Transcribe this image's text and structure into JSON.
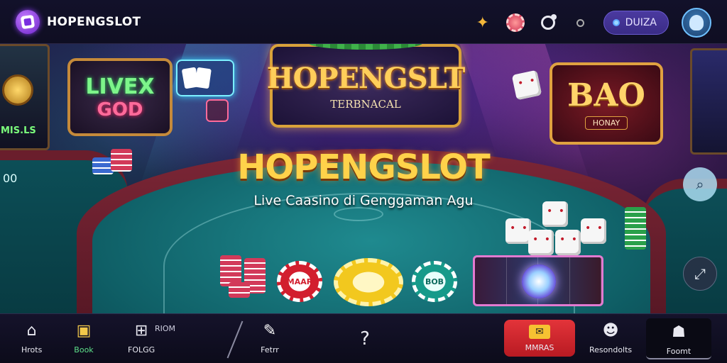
{
  "header": {
    "brand": "HOPENGSLOT",
    "pill_label": "DUIZA",
    "icons": [
      "logo-icon",
      "star-icon",
      "chip-icon",
      "ring-icon",
      "dot-icon",
      "avatar-icon"
    ]
  },
  "scene": {
    "main_sign": {
      "title": "HOPENGSLT",
      "subtitle": "TERBNACAL"
    },
    "live_sign": {
      "line1": "LIVEX",
      "line2": "GOD"
    },
    "bao_sign": {
      "title": "BAO",
      "subtitle": "HONAY"
    },
    "left_screen_label": "MIS.LS",
    "left_side_number": "00",
    "hero_title": "HOPENGSLOT",
    "hero_subtitle": "Live Caasino di Genggaman Agu",
    "chips": {
      "red": "MAAR",
      "yellow": "",
      "teal": "BOB"
    }
  },
  "bottom_nav": {
    "items": [
      {
        "label": "Hrots",
        "icon": "home-icon"
      },
      {
        "label": "Book",
        "icon": "book-icon"
      },
      {
        "label": "FOLGG",
        "icon": "map-icon"
      },
      {
        "label": "Fetrr",
        "icon": "flair-icon"
      },
      {
        "label": "",
        "icon": "help-icon"
      },
      {
        "label": "MMRAS",
        "icon": "ticket-icon"
      },
      {
        "label": "Resondolts",
        "icon": "person-icon"
      },
      {
        "label": "Foomt",
        "icon": "game-icon"
      }
    ],
    "extra_label": "RIOM"
  },
  "colors": {
    "accent": "#ffd24a",
    "nav_active": "#5ee08a",
    "cta": "#d21e2e",
    "pill": "#3a2c86"
  }
}
